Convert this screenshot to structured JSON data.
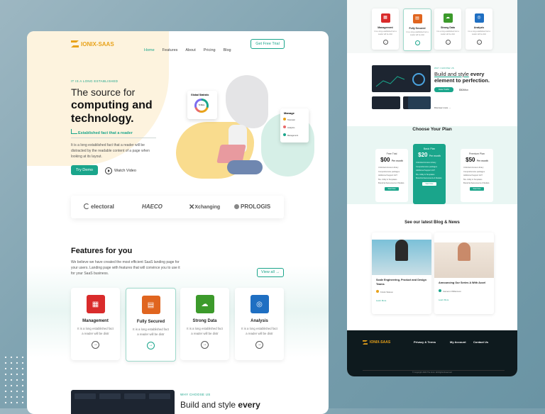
{
  "brand": "IONIX-SAAS",
  "nav": {
    "items": [
      "Home",
      "Features",
      "About",
      "Pricing",
      "Blog"
    ],
    "cta": "Get Free Trial"
  },
  "hero": {
    "eyebrow": "IT IS A LONG ESTABLISHED",
    "line1": "The source for",
    "line2": "computing and",
    "line3": "technology.",
    "tagline": "Established fact that a reader",
    "body": "It is a long established fact that a reader will be distracted by the readable content of a page when looking at its layout.",
    "try": "Try Demo",
    "watch": "Watch Video"
  },
  "hero_widgets": {
    "stats_title": "Global Statistic",
    "stats_value": "70 Mins",
    "manage": "Manage",
    "m1": "Telematic",
    "m2": "Analytics",
    "m3": "Management"
  },
  "partners": [
    "electoral",
    "HAECO",
    "Xchanging",
    "PROLOGIS"
  ],
  "features": {
    "title": "Features for you",
    "desc": "We believe we have created the most efficient SaaS landing page for your users. Landing page with features that will convince you to use it for your SaaS business.",
    "view_all": "View all",
    "cards": [
      {
        "title": "Management",
        "desc": "It is a long established fact a reader will be distr"
      },
      {
        "title": "Fully Secured",
        "desc": "It is a long established fact a reader will be distr"
      },
      {
        "title": "Strong Data",
        "desc": "It is a long established fact a reader will be distr"
      },
      {
        "title": "Analysis",
        "desc": "It is a long established fact a reader will be distr"
      }
    ]
  },
  "why": {
    "eyebrow": "WHY CHOOSE US",
    "title_a": "Build and style",
    "title_b": "every",
    "title_c": "element to perfection.",
    "btn": "Data Traffic",
    "stat": "$50/Mon",
    "more": "Discover more"
  },
  "plans": {
    "title": "Choose Your Plan",
    "items": [
      {
        "name": "Free Trial",
        "price": "$00",
        "per": "Per month"
      },
      {
        "name": "Basic Plan",
        "price": "$20",
        "per": "Per month"
      },
      {
        "name": "Premium Plan",
        "price": "$50",
        "per": "Per month"
      }
    ],
    "features": [
      "Unlimited Access Library",
      "Comprehensive packages",
      "Additional Support 24/7",
      "50+ Utility & Templates",
      "Brand Enhancements & Models"
    ],
    "btn": "Start Now"
  },
  "blog": {
    "title": "See our latest Blog & News",
    "posts": [
      {
        "title": "Scale Engineering, Product and Design Teams",
        "author": "Kristin Watson",
        "more": "Learn More"
      },
      {
        "title": "Announcing Our Series A With Accel",
        "author": "Cameron Williamson",
        "more": "Learn More"
      }
    ]
  },
  "footer": {
    "cols": [
      "Privacy & Terms",
      "My Account",
      "Contact Us"
    ],
    "copy": "© Copyright 2022 The Ionix. All Rights Reserved"
  },
  "colors": {
    "accent": "#1aa58b",
    "brand": "#e8a21a",
    "dark": "#0e1a1e"
  }
}
